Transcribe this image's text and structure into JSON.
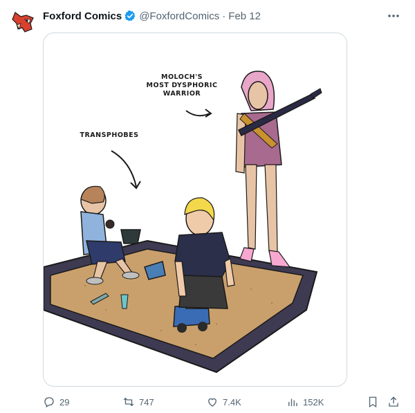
{
  "tweet": {
    "author_name": "Foxford Comics",
    "handle": "@FoxfordComics",
    "separator": "·",
    "date": "Feb 12"
  },
  "comic": {
    "label_moloch_line1": "MOLOCH'S",
    "label_moloch_line2": "MOST DYSPHORIC",
    "label_moloch_line3": "WARRIOR",
    "label_transphobes": "TRANSPHOBES"
  },
  "actions": {
    "replies": "29",
    "reposts": "747",
    "likes": "7.4K",
    "views": "152K"
  },
  "colors": {
    "accent": "#1d9bf0",
    "muted": "#536471",
    "sand": "#c9a06c",
    "sandbox_wood": "#3e3a52"
  }
}
